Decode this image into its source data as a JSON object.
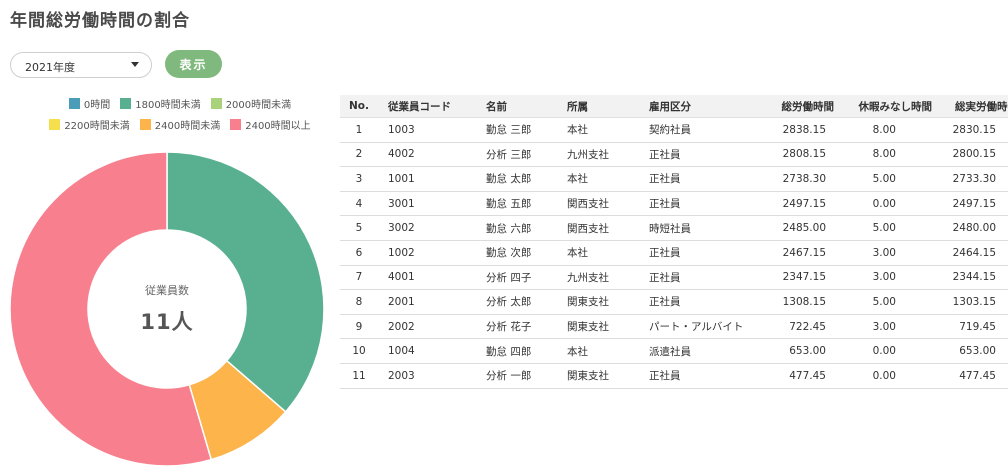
{
  "page_title": "年間総労働時間の割合",
  "year_select": {
    "value": "2021年度"
  },
  "show_button": "表示",
  "legend": [
    {
      "label": "0時間",
      "color": "#4b9cb8"
    },
    {
      "label": "1800時間未満",
      "color": "#58b090"
    },
    {
      "label": "2000時間未満",
      "color": "#a9d27b"
    },
    {
      "label": "2200時間未満",
      "color": "#f5df4d"
    },
    {
      "label": "2400時間未満",
      "color": "#fdb44b"
    },
    {
      "label": "2400時間以上",
      "color": "#f77f8e"
    }
  ],
  "donut": {
    "center_label": "従業員数",
    "center_value": "11人"
  },
  "chart_data": {
    "type": "pie",
    "categories": [
      "0時間",
      "1800時間未満",
      "2000時間未満",
      "2200時間未満",
      "2400時間未満",
      "2400時間以上"
    ],
    "values": [
      0,
      4,
      0,
      0,
      1,
      6
    ],
    "colors": [
      "#4b9cb8",
      "#58b090",
      "#a9d27b",
      "#f5df4d",
      "#fdb44b",
      "#f77f8e"
    ],
    "legend_position": "top"
  },
  "table": {
    "headers": [
      "No.",
      "従業員コード",
      "名前",
      "所属",
      "雇用区分",
      "総労働時間",
      "休暇みなし時間",
      "総実労働時間"
    ],
    "rows": [
      [
        "1",
        "1003",
        "勤怠 三郎",
        "本社",
        "契約社員",
        "2838.15",
        "8.00",
        "2830.15"
      ],
      [
        "2",
        "4002",
        "分析 三郎",
        "九州支社",
        "正社員",
        "2808.15",
        "8.00",
        "2800.15"
      ],
      [
        "3",
        "1001",
        "勤怠 太郎",
        "本社",
        "正社員",
        "2738.30",
        "5.00",
        "2733.30"
      ],
      [
        "4",
        "3001",
        "勤怠 五郎",
        "関西支社",
        "正社員",
        "2497.15",
        "0.00",
        "2497.15"
      ],
      [
        "5",
        "3002",
        "勤怠 六郎",
        "関西支社",
        "時短社員",
        "2485.00",
        "5.00",
        "2480.00"
      ],
      [
        "6",
        "1002",
        "勤怠 次郎",
        "本社",
        "正社員",
        "2467.15",
        "3.00",
        "2464.15"
      ],
      [
        "7",
        "4001",
        "分析 四子",
        "九州支社",
        "正社員",
        "2347.15",
        "3.00",
        "2344.15"
      ],
      [
        "8",
        "2001",
        "分析 太郎",
        "関東支社",
        "正社員",
        "1308.15",
        "5.00",
        "1303.15"
      ],
      [
        "9",
        "2002",
        "分析 花子",
        "関東支社",
        "パート・アルバイト",
        "722.45",
        "3.00",
        "719.45"
      ],
      [
        "10",
        "1004",
        "勤怠 四郎",
        "本社",
        "派遣社員",
        "653.00",
        "0.00",
        "653.00"
      ],
      [
        "11",
        "2003",
        "分析 一郎",
        "関東支社",
        "正社員",
        "477.45",
        "0.00",
        "477.45"
      ]
    ]
  }
}
